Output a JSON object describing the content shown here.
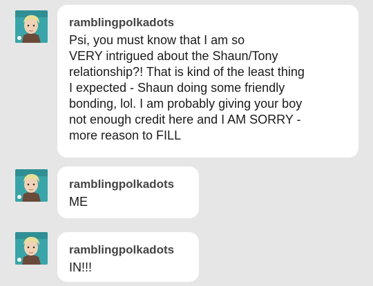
{
  "messages": [
    {
      "username": "ramblingpolkadots",
      "avatar_icon": "avatar-icon",
      "text": "Psi, you must know that I am so\nVERY intrigued about the Shaun/Tony\nrelationship?! That is kind of the least thing\nI expected - Shaun doing some friendly\nbonding, lol. I am probably giving your boy\nnot enough credit here and I AM SORRY -\nmore reason to FILL"
    },
    {
      "username": "ramblingpolkadots",
      "avatar_icon": "avatar-icon",
      "text": "ME"
    },
    {
      "username": "ramblingpolkadots",
      "avatar_icon": "avatar-icon",
      "text": "IN!!!"
    }
  ],
  "colors": {
    "background": "#e6e6e6",
    "bubble": "#ffffff",
    "username": "#444444",
    "text": "#1a1a1a"
  }
}
